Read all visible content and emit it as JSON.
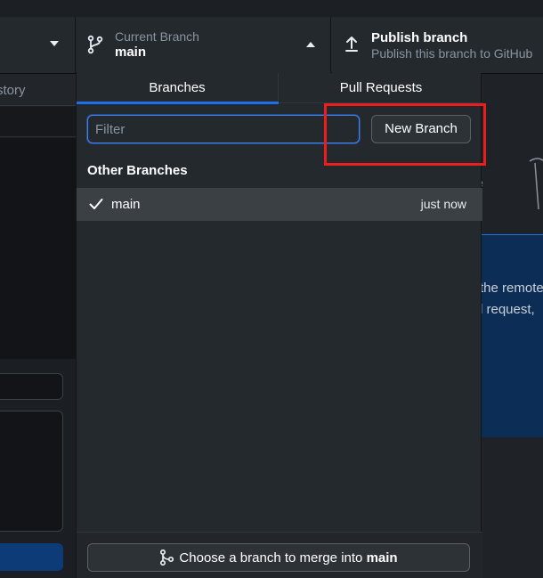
{
  "toolbar": {
    "current_branch_label": "Current Branch",
    "current_branch_name": "main",
    "publish_title": "Publish branch",
    "publish_subtitle": "Publish this branch to GitHub"
  },
  "sidebar": {
    "history_tab": "story"
  },
  "background": {
    "right_fragment_e": "e",
    "right_text_line1": "the remote",
    "right_text_line2": "l request,"
  },
  "dropdown": {
    "tabs": [
      {
        "label": "Branches",
        "selected": true
      },
      {
        "label": "Pull Requests",
        "selected": false
      }
    ],
    "filter_placeholder": "Filter",
    "new_branch_label": "New Branch",
    "section_header": "Other Branches",
    "branches": [
      {
        "name": "main",
        "time": "just now",
        "checked": true
      }
    ],
    "merge_prefix": "Choose a branch to merge into",
    "merge_target": "main"
  },
  "colors": {
    "accent": "#1f6feb",
    "highlight": "#ec1d1d"
  }
}
